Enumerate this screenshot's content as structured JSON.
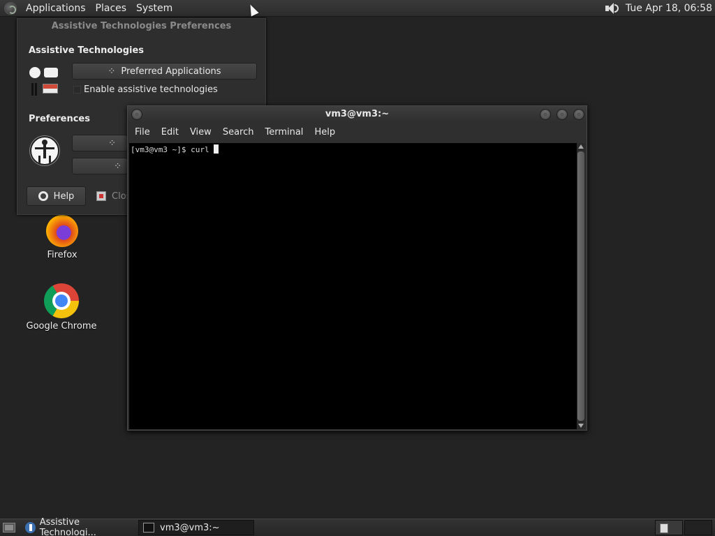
{
  "top_panel": {
    "menus": [
      "Applications",
      "Places",
      "System"
    ],
    "clock": "Tue Apr 18, 06:58"
  },
  "at_window": {
    "title": "Assistive Technologies Preferences",
    "section_at": "Assistive Technologies",
    "preferred_apps_label": "Preferred Applications",
    "enable_label": "Enable assistive technologies",
    "section_prefs": "Preferences",
    "help_label": "Help",
    "close_label": "Close"
  },
  "desktop": {
    "icons": [
      {
        "label": "Firefox"
      },
      {
        "label": "Google Chrome"
      }
    ]
  },
  "terminal": {
    "title": "vm3@vm3:~",
    "menus": [
      "File",
      "Edit",
      "View",
      "Search",
      "Terminal",
      "Help"
    ],
    "prompt": "[vm3@vm3 ~]$ curl"
  },
  "bottom_panel": {
    "tasks": [
      "Assistive Technologi...",
      "vm3@vm3:~"
    ]
  }
}
